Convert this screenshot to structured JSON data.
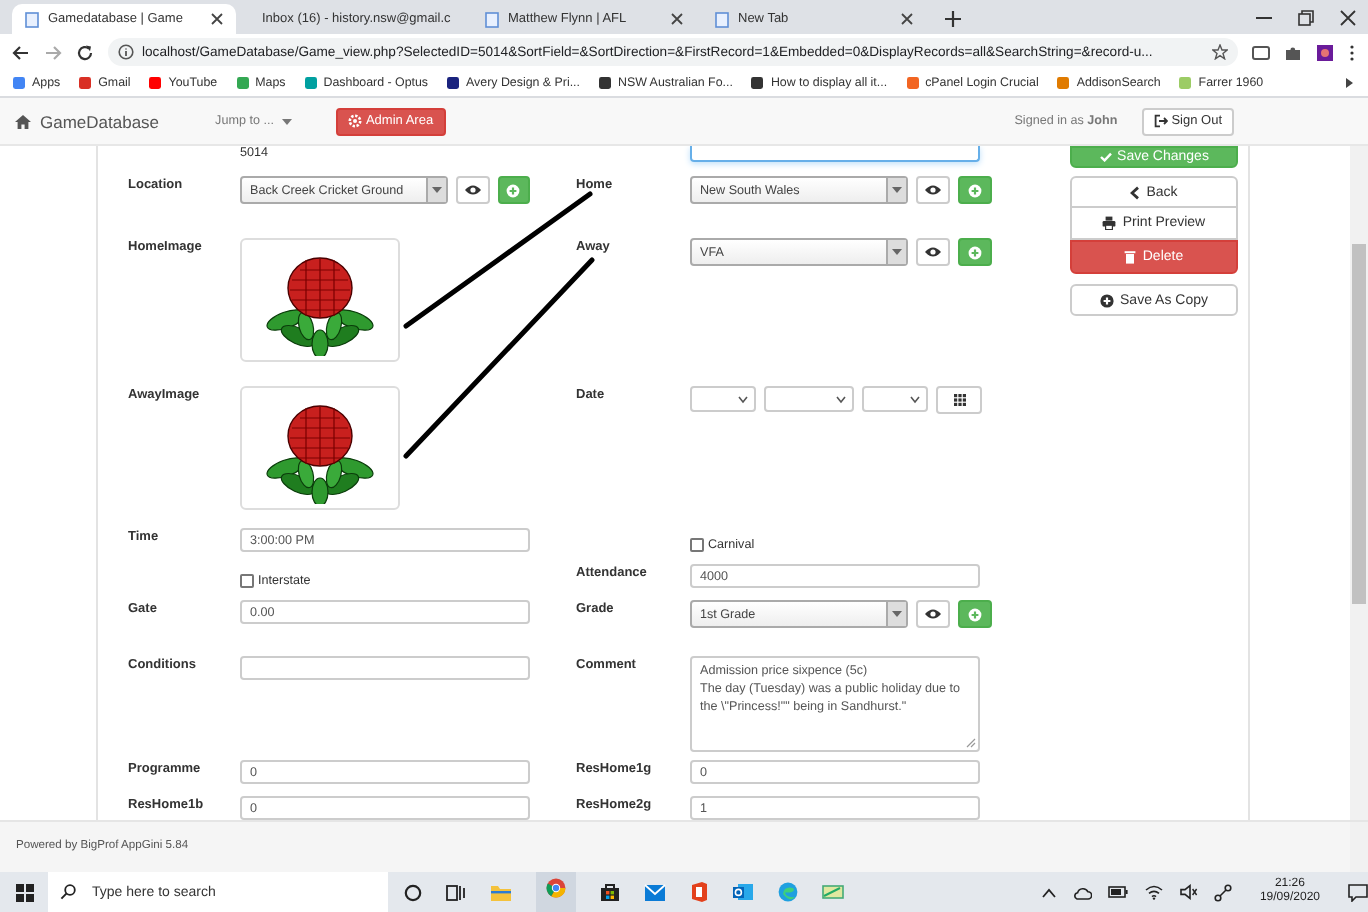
{
  "browser": {
    "tabs": [
      {
        "title": "Gamedatabase | Game",
        "selected": true
      },
      {
        "title": "Inbox (16) - history.nsw@gmail.c",
        "selected": false
      },
      {
        "title": "Matthew Flynn | AFL",
        "selected": false
      },
      {
        "title": "New Tab",
        "selected": false
      }
    ],
    "url": "localhost/GameDatabase/Game_view.php?SelectedID=5014&SortField=&SortDirection=&FirstRecord=1&Embedded=0&DisplayRecords=all&SearchString=&record-u...",
    "bookmarks": [
      "Apps",
      "Gmail",
      "YouTube",
      "Maps",
      "Dashboard - Optus",
      "Avery Design & Pri...",
      "NSW Australian Fo...",
      "How to display all it...",
      "cPanel Login Crucial",
      "AddisonSearch",
      "Farrer 1960"
    ]
  },
  "navbar": {
    "brand": "GameDatabase",
    "jump": "Jump to ...",
    "admin": "Admin Area",
    "signed_in": "Signed in as **John**",
    "sign_out": "Sign Out"
  },
  "form": {
    "record_id": "5014",
    "location": {
      "label": "Location",
      "value": "Back Creek Cricket Ground"
    },
    "home": {
      "label": "Home",
      "value": "New South Wales"
    },
    "home_image": {
      "label": "HomeImage"
    },
    "away": {
      "label": "Away",
      "value": "VFA"
    },
    "away_image": {
      "label": "AwayImage"
    },
    "date": {
      "label": "Date"
    },
    "time": {
      "label": "Time",
      "value": "3:00:00 PM"
    },
    "carnival": {
      "label": "Carnival",
      "checked": false
    },
    "interstate": {
      "label": "Interstate",
      "checked": false
    },
    "attendance": {
      "label": "Attendance",
      "value": "4000"
    },
    "gate": {
      "label": "Gate",
      "value": "0.00"
    },
    "grade": {
      "label": "Grade",
      "value": "1st Grade"
    },
    "conditions": {
      "label": "Conditions"
    },
    "comment": {
      "label": "Comment",
      "value": "Admission price sixpence (5c)\nThe day (Tuesday) was a public holiday due to the \\\"Princess!\"\" being in Sandhurst.\""
    },
    "programme": {
      "label": "Programme",
      "value": "0"
    },
    "res_home_1g": {
      "label": "ResHome1g",
      "value": "0"
    },
    "res_home_1b": {
      "label": "ResHome1b",
      "value": "0"
    },
    "res_home_2g": {
      "label": "ResHome2g",
      "value": "1"
    }
  },
  "actions": {
    "save": "Save Changes",
    "buttons": [
      {
        "label": "Back",
        "kind": "back"
      },
      {
        "label": "Print Preview",
        "kind": "print"
      },
      {
        "label": "Delete",
        "kind": "delete"
      },
      {
        "label": "Save As Copy",
        "kind": "copy"
      }
    ]
  },
  "footer": "Powered by BigProf AppGini 5.84",
  "taskbar": {
    "search_placeholder": "Type here to search",
    "time": "21:26",
    "date": "19/09/2020"
  }
}
